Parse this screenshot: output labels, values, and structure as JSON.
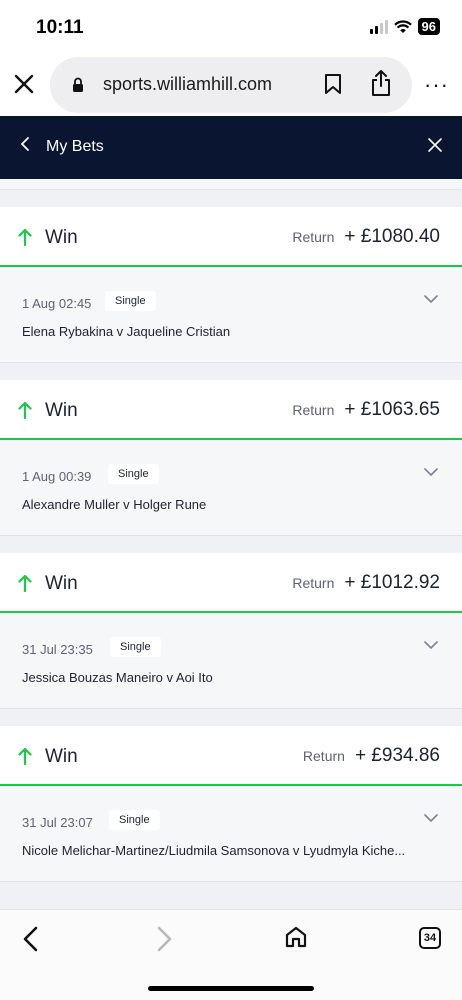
{
  "status_bar": {
    "time": "10:11",
    "battery": "96"
  },
  "browser": {
    "url": "sports.williamhill.com",
    "tab_count": "34"
  },
  "header": {
    "title": "My Bets"
  },
  "colors": {
    "win_green": "#1cc84a",
    "header_navy": "#0a1532"
  },
  "bets": [
    {
      "result": "Win",
      "return_label": "Return",
      "return_amount": "+ £1080.40",
      "date": "1 Aug 02:45",
      "type": "Single",
      "event": "Elena Rybakina v Jaqueline Cristian"
    },
    {
      "result": "Win",
      "return_label": "Return",
      "return_amount": "+ £1063.65",
      "date": "1 Aug 00:39",
      "type": "Single",
      "event": "Alexandre Muller v Holger Rune"
    },
    {
      "result": "Win",
      "return_label": "Return",
      "return_amount": "+ £1012.92",
      "date": "31 Jul 23:35",
      "type": "Single",
      "event": "Jessica Bouzas Maneiro v Aoi Ito"
    },
    {
      "result": "Win",
      "return_label": "Return",
      "return_amount": "+ £934.86",
      "date": "31 Jul 23:07",
      "type": "Single",
      "event": "Nicole Melichar-Martinez/Liudmila Samsonova v Lyudmyla Kiche..."
    }
  ]
}
